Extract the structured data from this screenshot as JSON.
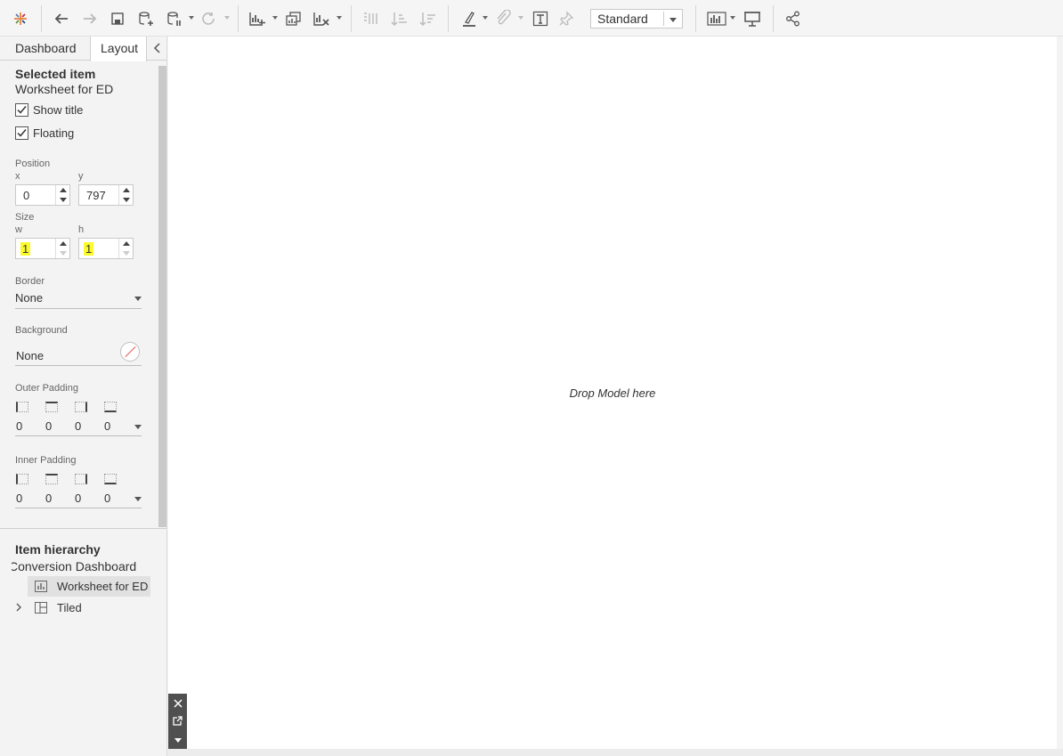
{
  "toolbar": {
    "icons": [
      "tableau-logo-icon",
      "undo-icon",
      "redo-icon",
      "save-icon",
      "new-data-source-icon",
      "pause-updates-icon",
      "refresh-icon",
      "new-worksheet-icon",
      "duplicate-sheet-icon",
      "clear-sheet-icon",
      "swap-rows-columns-icon",
      "sort-ascending-icon",
      "sort-descending-icon",
      "highlight-icon",
      "group-icon",
      "show-labels-icon",
      "fix-axes-icon",
      "fit-icon",
      "show-me-icon",
      "presentation-mode-icon",
      "share-icon"
    ],
    "fit_value": "Standard"
  },
  "panel": {
    "tabs": [
      "Dashboard",
      "Layout"
    ],
    "active_tab": "Layout",
    "selected_item": {
      "heading": "Selected item",
      "name": "Worksheet for ED",
      "show_title_label": "Show title",
      "show_title_checked": true,
      "floating_label": "Floating",
      "floating_checked": true
    },
    "position": {
      "label": "Position",
      "x_label": "x",
      "x_value": "0",
      "y_label": "y",
      "y_value": "797"
    },
    "size": {
      "label": "Size",
      "w_label": "w",
      "w_value": "1",
      "h_label": "h",
      "h_value": "1"
    },
    "border": {
      "label": "Border",
      "value": "None"
    },
    "background": {
      "label": "Background",
      "value": "None"
    },
    "outer_padding": {
      "label": "Outer Padding",
      "values": [
        "0",
        "0",
        "0",
        "0"
      ]
    },
    "inner_padding": {
      "label": "Inner Padding",
      "values": [
        "0",
        "0",
        "0",
        "0"
      ]
    },
    "hierarchy": {
      "heading": "Item hierarchy",
      "root": "Conversion Dashboard",
      "items": [
        {
          "label": "Worksheet for ED",
          "icon": "worksheet-icon",
          "selected": true
        },
        {
          "label": "Tiled",
          "icon": "tiled-container-icon",
          "selected": false
        }
      ]
    }
  },
  "canvas": {
    "drop_hint": "Drop Model here"
  },
  "colors": {
    "highlight": "#fbfb2c",
    "toolbar_bg": "#f5f5f5",
    "selected_row": "#e1e1e1"
  }
}
